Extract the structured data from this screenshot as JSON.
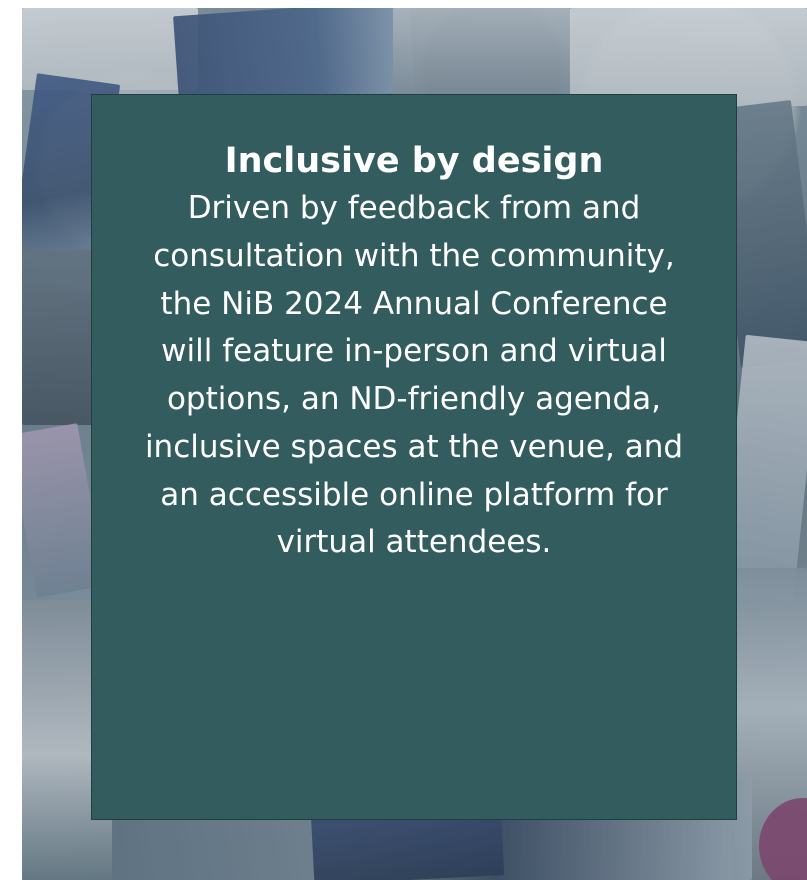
{
  "card": {
    "title": "Inclusive by design",
    "body": "Driven by feedback from and consultation with the community, the NiB 2024 Annual Conference will feature in-person and virtual options, an ND-friendly agenda, inclusive spaces at the venue, and an accessible online platform for virtual attendees."
  },
  "colors": {
    "card_background": "#335c5f",
    "card_text": "#ffffff",
    "card_border": "#1f3f43"
  }
}
